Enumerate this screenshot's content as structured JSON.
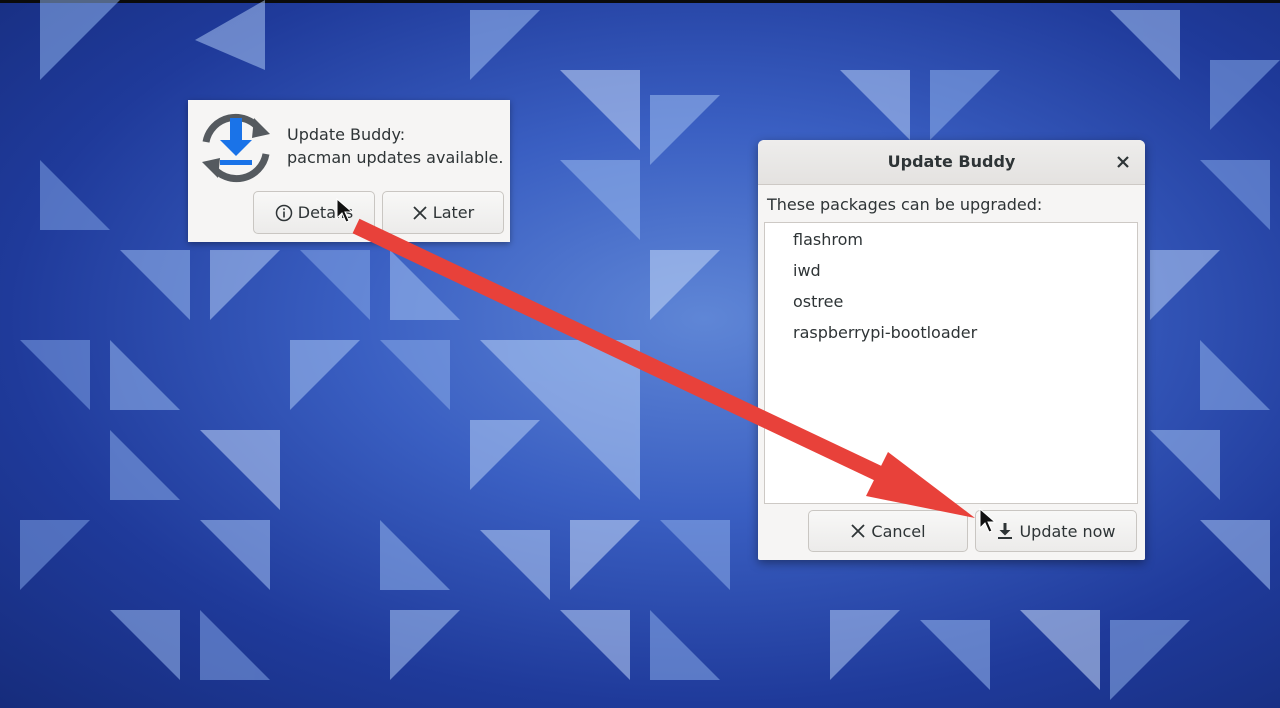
{
  "notification": {
    "app_name": "Update Buddy:",
    "message": "pacman updates available.",
    "icon": "download-sync-icon",
    "details_label": "Details",
    "details_icon": "info-icon",
    "later_label": "Later",
    "later_icon": "close-x-icon"
  },
  "dialog": {
    "title": "Update Buddy",
    "close_icon": "close-icon",
    "prompt": "These packages can be upgraded:",
    "packages": [
      "flashrom",
      "iwd",
      "ostree",
      "raspberrypi-bootloader"
    ],
    "cancel_label": "Cancel",
    "cancel_icon": "close-x-icon",
    "update_label": "Update now",
    "update_icon": "download-icon"
  },
  "colors": {
    "accent_blue": "#1a73e8",
    "arrow_red": "#e8413a",
    "window_bg": "#f6f5f4",
    "text": "#2e3436"
  }
}
